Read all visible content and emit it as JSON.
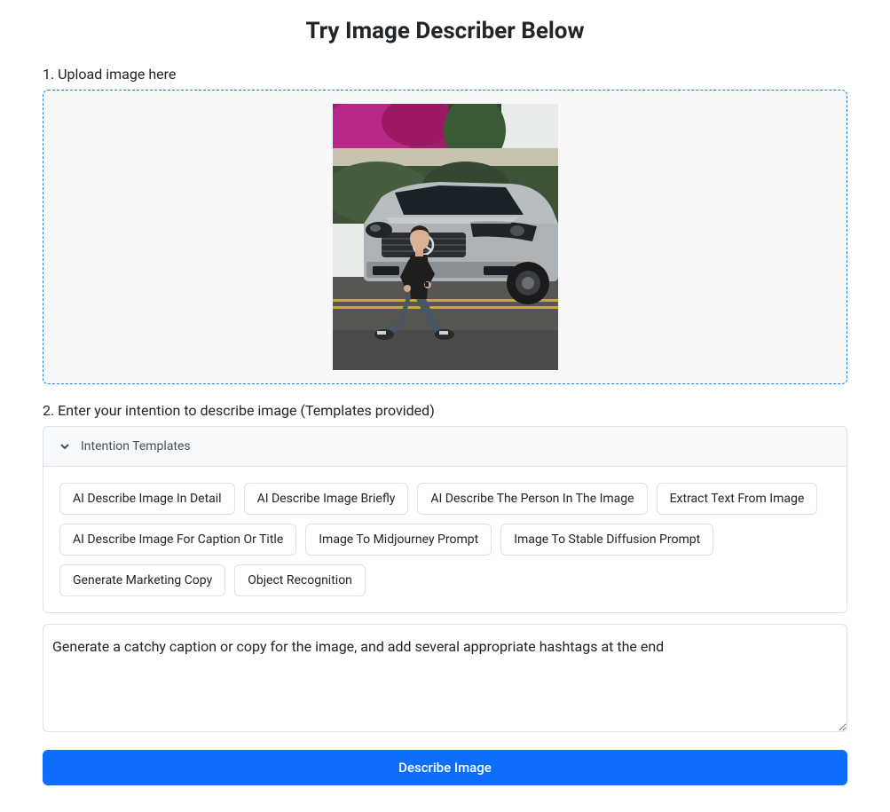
{
  "page_title": "Try Image Describer Below",
  "upload": {
    "label": "1. Upload image here"
  },
  "intention": {
    "label": "2. Enter your intention to describe image (Templates provided)",
    "templates_header": "Intention Templates",
    "templates": [
      "AI Describe Image In Detail",
      "AI Describe Image Briefly",
      "AI Describe The Person In The Image",
      "Extract Text From Image",
      "AI Describe Image For Caption Or Title",
      "Image To Midjourney Prompt",
      "Image To Stable Diffusion Prompt",
      "Generate Marketing Copy",
      "Object Recognition"
    ],
    "textarea_value": "Generate a catchy caption or copy for the image, and add several appropriate hashtags at the end"
  },
  "describe_button_label": "Describe Image"
}
